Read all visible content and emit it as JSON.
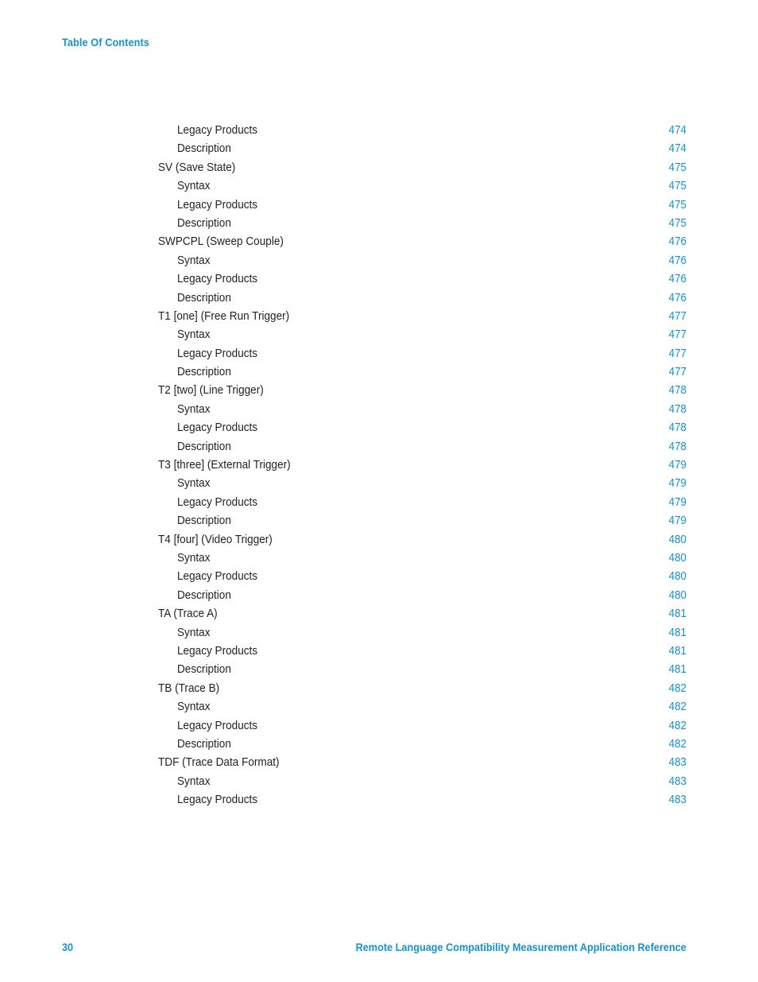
{
  "header": {
    "title": "Table Of Contents"
  },
  "colors": {
    "accent_blue": "#1a8fd0",
    "body_text": "#231f20",
    "page_background": "#ffffff"
  },
  "toc": {
    "entries": [
      {
        "label": "Legacy Products",
        "page": "474",
        "level": 2
      },
      {
        "label": "Description",
        "page": "474",
        "level": 2
      },
      {
        "label": "SV (Save State)",
        "page": "475",
        "level": 1
      },
      {
        "label": "Syntax",
        "page": "475",
        "level": 2
      },
      {
        "label": "Legacy Products",
        "page": "475",
        "level": 2
      },
      {
        "label": "Description",
        "page": "475",
        "level": 2
      },
      {
        "label": "SWPCPL (Sweep Couple)",
        "page": "476",
        "level": 1
      },
      {
        "label": "Syntax",
        "page": "476",
        "level": 2
      },
      {
        "label": "Legacy Products",
        "page": "476",
        "level": 2
      },
      {
        "label": "Description",
        "page": "476",
        "level": 2
      },
      {
        "label": "T1 [one] (Free Run Trigger)",
        "page": "477",
        "level": 1
      },
      {
        "label": "Syntax",
        "page": "477",
        "level": 2
      },
      {
        "label": "Legacy Products",
        "page": "477",
        "level": 2
      },
      {
        "label": "Description",
        "page": "477",
        "level": 2
      },
      {
        "label": "T2 [two] (Line Trigger)",
        "page": "478",
        "level": 1
      },
      {
        "label": "Syntax",
        "page": "478",
        "level": 2
      },
      {
        "label": "Legacy Products",
        "page": "478",
        "level": 2
      },
      {
        "label": "Description",
        "page": "478",
        "level": 2
      },
      {
        "label": "T3 [three] (External Trigger)",
        "page": "479",
        "level": 1
      },
      {
        "label": "Syntax",
        "page": "479",
        "level": 2
      },
      {
        "label": "Legacy Products",
        "page": "479",
        "level": 2
      },
      {
        "label": "Description",
        "page": "479",
        "level": 2
      },
      {
        "label": "T4 [four] (Video Trigger)",
        "page": "480",
        "level": 1
      },
      {
        "label": "Syntax",
        "page": "480",
        "level": 2
      },
      {
        "label": "Legacy Products",
        "page": "480",
        "level": 2
      },
      {
        "label": "Description",
        "page": "480",
        "level": 2
      },
      {
        "label": "TA (Trace A)",
        "page": "481",
        "level": 1
      },
      {
        "label": "Syntax",
        "page": "481",
        "level": 2
      },
      {
        "label": "Legacy Products",
        "page": "481",
        "level": 2
      },
      {
        "label": "Description",
        "page": "481",
        "level": 2
      },
      {
        "label": "TB (Trace B)",
        "page": "482",
        "level": 1
      },
      {
        "label": "Syntax",
        "page": "482",
        "level": 2
      },
      {
        "label": "Legacy Products",
        "page": "482",
        "level": 2
      },
      {
        "label": "Description",
        "page": "482",
        "level": 2
      },
      {
        "label": "TDF (Trace Data Format)",
        "page": "483",
        "level": 1
      },
      {
        "label": "Syntax",
        "page": "483",
        "level": 2
      },
      {
        "label": "Legacy Products",
        "page": "483",
        "level": 2
      }
    ]
  },
  "footer": {
    "page_number": "30",
    "document_title": "Remote Language Compatibility Measurement Application Reference"
  }
}
